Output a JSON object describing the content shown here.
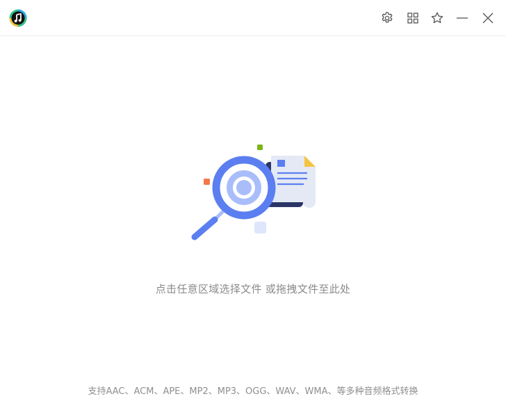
{
  "titlebar": {
    "buttons": [
      {
        "icon": "gear-icon",
        "label": "settings"
      },
      {
        "icon": "grid-icon",
        "label": "apps"
      },
      {
        "icon": "star-icon",
        "label": "favorite"
      },
      {
        "icon": "minimize-icon",
        "label": "minimize"
      },
      {
        "icon": "close-icon",
        "label": "close"
      }
    ]
  },
  "main": {
    "drop_hint": "点击任意区域选择文件 或拖拽文件至此处",
    "formats_note": "支持AAC、ACM、APE、MP2、MP3、OGG、WAV、WMA、等多种音频格式转换"
  },
  "colors": {
    "accent": "#5b7ff0",
    "accent_light": "#a9bdfb",
    "doc_bg": "#e4e9f5",
    "doc_dark": "#2b3566",
    "orange": "#f27a4a",
    "green": "#7cb518",
    "yellow": "#f5c443"
  }
}
